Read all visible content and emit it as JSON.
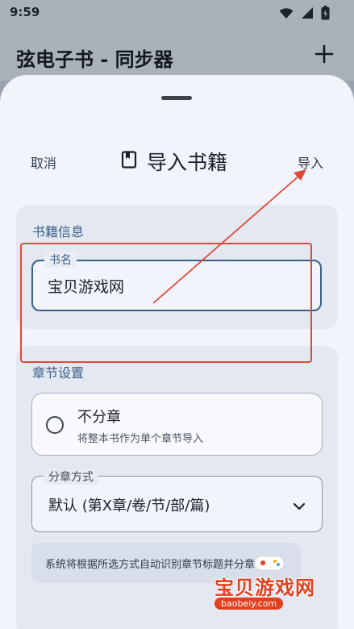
{
  "status_bar": {
    "time": "9:59",
    "icons": [
      "wifi-icon",
      "signal-icon",
      "battery-icon"
    ]
  },
  "app_bar": {
    "title": "弦电子书 - 同步器",
    "add_icon": "plus-icon"
  },
  "sheet": {
    "cancel_label": "取消",
    "title": "导入书籍",
    "title_icon": "book-icon",
    "import_label": "导入",
    "book_info": {
      "heading": "书籍信息",
      "name_label": "书名",
      "name_value": "宝贝游戏网"
    },
    "chapter_settings": {
      "heading": "章节设置",
      "no_split_title": "不分章",
      "no_split_desc": "将整本书作为单个章节导入",
      "split_method_label": "分章方式",
      "split_method_value": "默认 (第X章/卷/节/部/篇)",
      "info_text": "系统将根据所选方式自动识别章节标题并分章"
    }
  },
  "watermark": {
    "text": "宝贝游戏网",
    "url": "baobeiy.com"
  },
  "colors": {
    "accent": "#3a5f88",
    "annotation": "#e0483a",
    "sheet_bg": "#f2f4fb",
    "card_bg": "#e3e8f1"
  }
}
